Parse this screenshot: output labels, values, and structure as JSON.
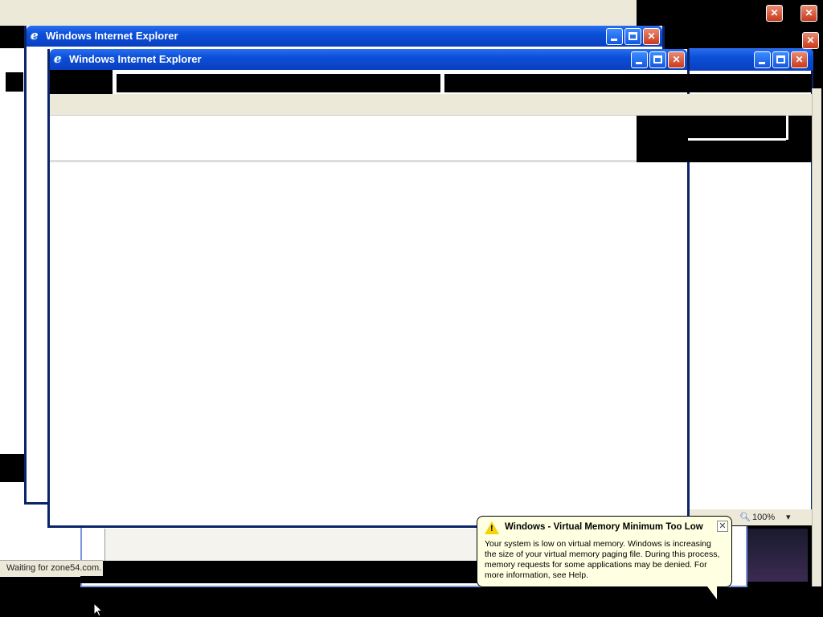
{
  "windows": {
    "back_title": "Windows Internet Explorer",
    "front_title": "Windows Internet Explorer"
  },
  "title_buttons": {
    "minimize": "_",
    "maximize": "□",
    "close": "✕"
  },
  "status_bar": {
    "waiting_text": "Waiting for zone54.com.",
    "zoom": "100%",
    "zoom_dropdown": "▾"
  },
  "balloon": {
    "title": "Windows - Virtual Memory Minimum Too Low",
    "body": "Your system is low on virtual memory. Windows is increasing the size of your virtual memory paging file. During this process, memory requests for some applications may be denied. For more information, see Help.",
    "close": "✕",
    "warning_mark": "!"
  },
  "colors": {
    "xp_blue": "#0b4fd8",
    "close_red": "#c93a1b",
    "balloon_bg": "#ffffe1"
  }
}
